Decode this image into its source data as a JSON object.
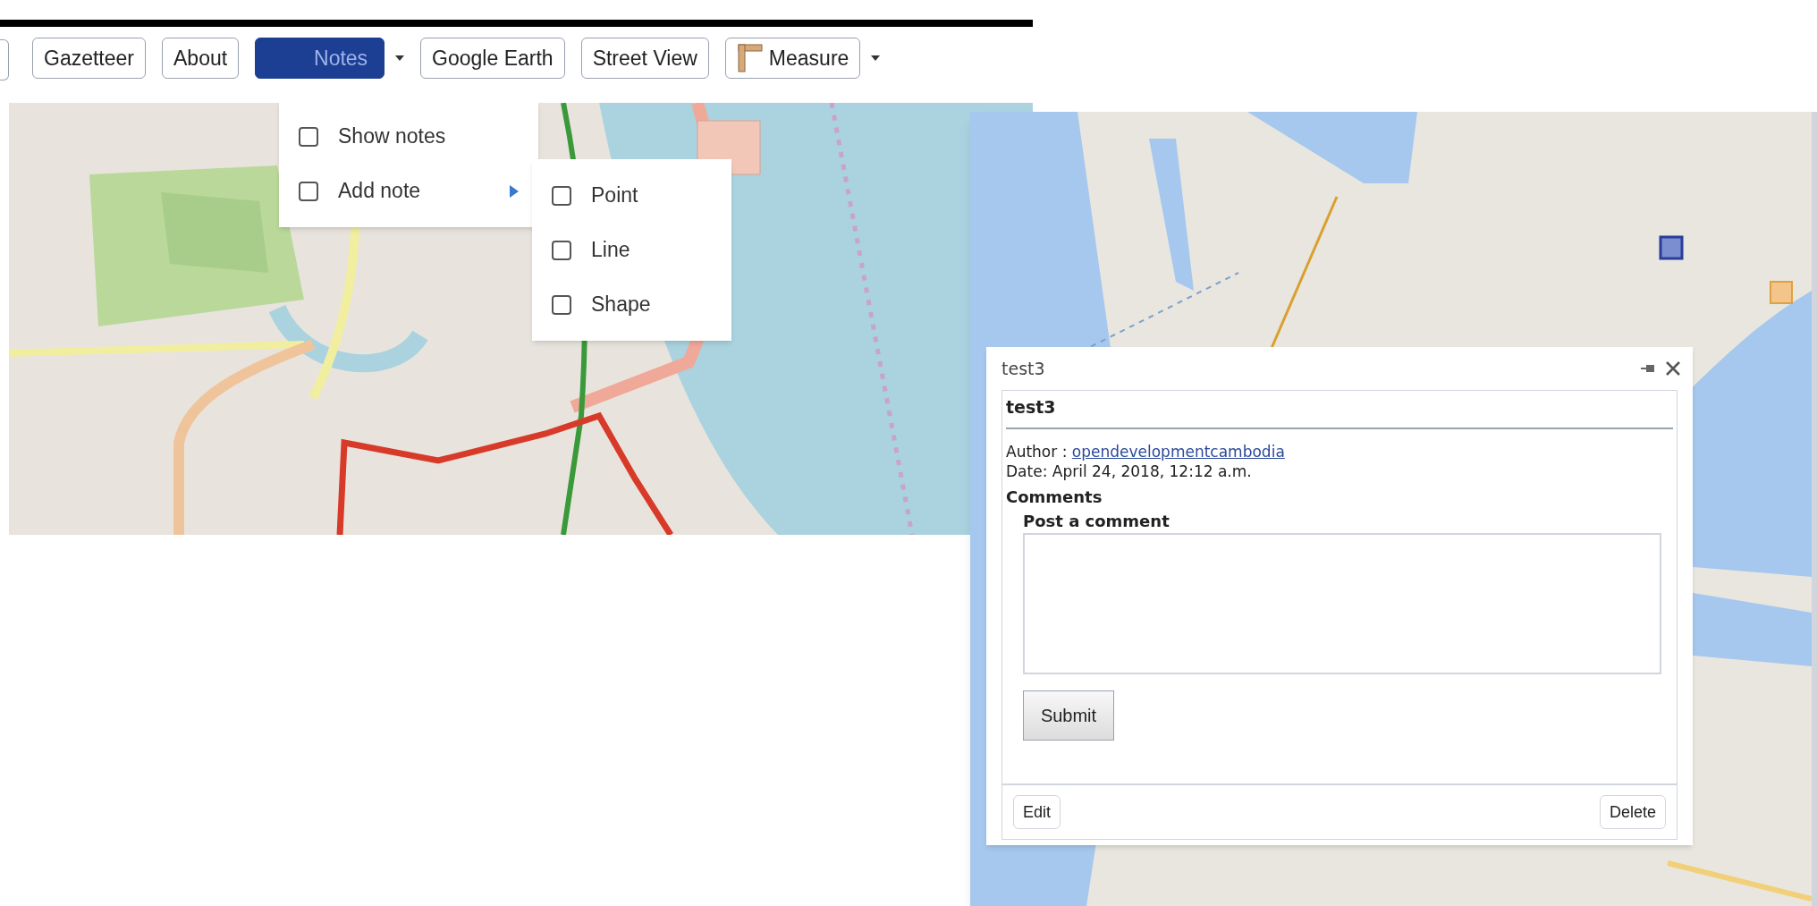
{
  "toolbar": {
    "buttons": [
      {
        "label": "Gazetteer",
        "kind": "plain",
        "selected": false,
        "dropdown": false
      },
      {
        "label": "About",
        "kind": "plain",
        "selected": false,
        "dropdown": false
      },
      {
        "label": "Notes",
        "kind": "plain",
        "selected": true,
        "dropdown": true
      },
      {
        "label": "Google Earth",
        "kind": "plain",
        "selected": false,
        "dropdown": false
      },
      {
        "label": "Street View",
        "kind": "plain",
        "selected": false,
        "dropdown": false
      },
      {
        "label": "Measure",
        "kind": "ruler",
        "selected": false,
        "dropdown": true
      }
    ]
  },
  "notes_menu": {
    "items": [
      {
        "label": "Show notes",
        "checked": false,
        "has_submenu": false
      },
      {
        "label": "Add note",
        "checked": false,
        "has_submenu": true
      }
    ]
  },
  "add_note_submenu": {
    "items": [
      {
        "label": "Point",
        "checked": false
      },
      {
        "label": "Line",
        "checked": false
      },
      {
        "label": "Shape",
        "checked": false
      }
    ]
  },
  "note_popup": {
    "title": "test3",
    "heading": "test3",
    "author_label": "Author :",
    "author": "opendevelopmentcambodia",
    "date": "Date: April 24, 2018, 12:12 a.m.",
    "comments_heading": "Comments",
    "post_heading": "Post a comment",
    "submit": "Submit",
    "edit": "Edit",
    "delete": "Delete"
  }
}
